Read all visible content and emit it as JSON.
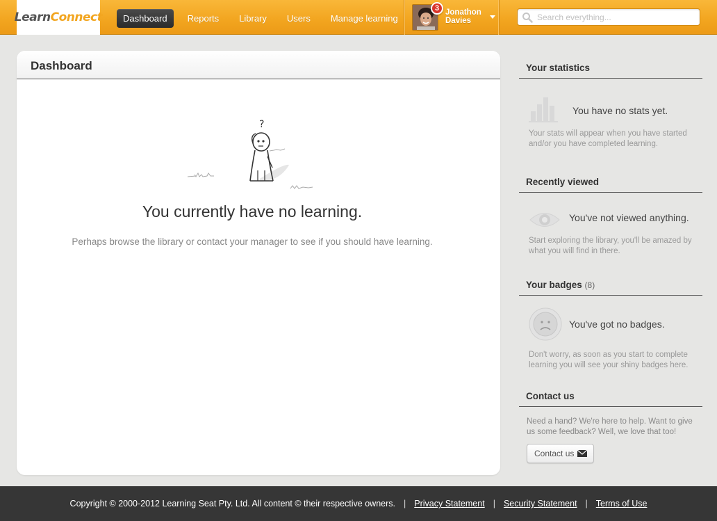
{
  "logo": {
    "part1": "Learn",
    "part2": "Connect"
  },
  "nav": {
    "items": [
      {
        "label": "Dashboard",
        "active": true
      },
      {
        "label": "Reports"
      },
      {
        "label": "Library"
      },
      {
        "label": "Users"
      },
      {
        "label": "Manage learning"
      }
    ]
  },
  "user": {
    "first_name": "Jonathon",
    "last_name": "Davies",
    "notifications": "3"
  },
  "search": {
    "placeholder": "Search everything..."
  },
  "main": {
    "title": "Dashboard",
    "empty_title": "You currently have no learning.",
    "empty_subtitle": "Perhaps browse the library or contact your manager to see if you should have learning.",
    "illustration_mark": "?"
  },
  "sidebar": {
    "statistics": {
      "title": "Your statistics",
      "lead": "You have no stats yet.",
      "desc": "Your stats will appear when you have started and/or you have completed learning."
    },
    "recent": {
      "title": "Recently viewed",
      "lead": "You've not viewed anything.",
      "desc": "Start exploring the library, you'll be amazed by what you will find in there."
    },
    "badges": {
      "title": "Your badges",
      "count": "(8)",
      "lead": "You've got no badges.",
      "desc": "Don't worry, as soon as you start to complete learning you will see your shiny badges here."
    },
    "contact": {
      "title": "Contact us",
      "desc": "Need a hand? We're here to help. Want to give us some feedback? Well, we love that too!",
      "button": "Contact us"
    }
  },
  "footer": {
    "copyright": "Copyright © 2000-2012 Learning Seat Pty. Ltd. All content © their respective owners.",
    "sep": "|",
    "links": [
      "Privacy Statement",
      "Security Statement",
      "Terms of Use"
    ]
  }
}
